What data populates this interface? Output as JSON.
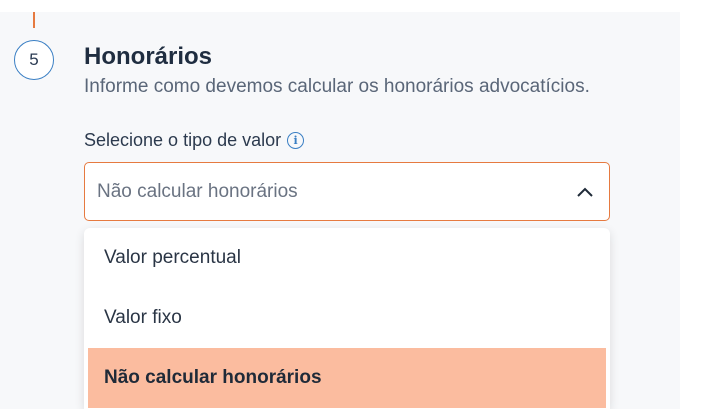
{
  "section": {
    "step_number": "5",
    "title": "Honorários",
    "description": "Informe como devemos calcular os honorários advocatícios."
  },
  "field": {
    "label": "Selecione o tipo de valor",
    "info_icon": "info-icon",
    "selected_value": "Não calcular honorários",
    "open": true
  },
  "dropdown": {
    "options": [
      {
        "label": "Valor percentual",
        "selected": false
      },
      {
        "label": "Valor fixo",
        "selected": false
      },
      {
        "label": "Não calcular honorários",
        "selected": true
      }
    ]
  },
  "colors": {
    "accent": "#e67a40",
    "selected_bg": "#fbbc9f",
    "step_border": "#3a7fc4"
  }
}
